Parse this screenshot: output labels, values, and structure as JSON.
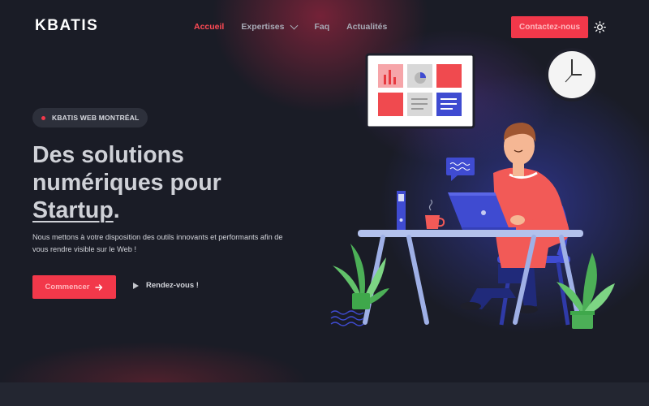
{
  "header": {
    "logo": "KBATIS",
    "nav": [
      {
        "label": "Accueil",
        "active": true
      },
      {
        "label": "Expertises",
        "dropdown": true
      },
      {
        "label": "Faq"
      },
      {
        "label": "Actualités"
      }
    ],
    "contact_label": "Contactez-nous",
    "theme_icon": "sun-icon"
  },
  "hero": {
    "badge": "KBATIS WEB MONTRÉAL",
    "title_line1": "Des solutions",
    "title_line2": "numériques pour",
    "title_highlight": "Startup",
    "title_end": ".",
    "description": "Nous mettons à votre disposition des outils innovants et performants afin de vous rendre visible sur le Web !",
    "cta_primary": "Commencer",
    "cta_secondary": "Rendez-vous !"
  },
  "colors": {
    "accent": "#f2384a",
    "background": "#1a1c26",
    "nav_text": "#a8abb6"
  }
}
